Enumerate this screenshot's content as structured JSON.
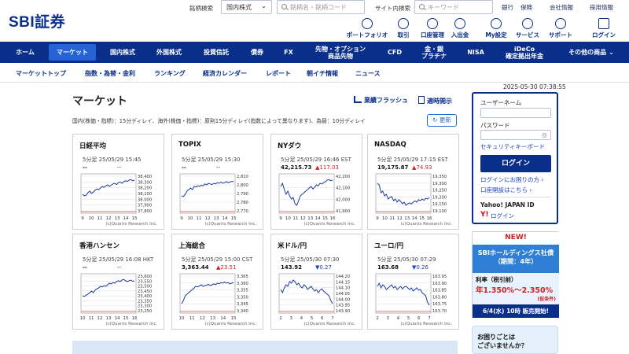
{
  "header": {
    "logo": "SBI証券",
    "search_label": "銘柄検索",
    "market_select": "国内株式",
    "stock_search_placeholder": "銘柄名・銘柄コード",
    "site_search_label": "サイト内検索",
    "keyword_placeholder": "キーワード",
    "links": [
      "銀行",
      "保険",
      "会社情報",
      "採用情報"
    ],
    "icons": [
      {
        "label": "ポートフォリオ",
        "icon": "portfolio-icon"
      },
      {
        "label": "取引",
        "icon": "trade-icon"
      },
      {
        "label": "口座管理",
        "icon": "account-icon"
      },
      {
        "label": "入出金",
        "icon": "yen-icon"
      },
      {
        "label": "My設定",
        "icon": "user-settings-icon"
      },
      {
        "label": "サービス",
        "icon": "services-icon"
      },
      {
        "label": "サポート",
        "icon": "support-icon"
      },
      {
        "label": "ログイン",
        "icon": "login-icon"
      }
    ]
  },
  "nav": [
    "ホーム",
    "マーケット",
    "国内株式",
    "外国株式",
    "投資信託",
    "債券",
    "FX",
    "先物・オプション\n商品先物",
    "CFD",
    "金・銀\nプラチナ",
    "NISA",
    "iDeCo\n確定拠出年金",
    "その他の商品"
  ],
  "subnav": [
    "マーケットトップ",
    "指数・為替・金利",
    "ランキング",
    "経済カレンダー",
    "レポート",
    "朝イチ情報",
    "ニュース"
  ],
  "timestamp": "2025-05-30 07:38:55",
  "page_title": "マーケット",
  "header_links": [
    "業績フラッシュ",
    "適時開示"
  ],
  "delay_note": "国内(株価・指標)：15分ディレイ、海外(株価・指標)：原則15分ディレイ(指数によって異なります)、為替：10分ディレイ",
  "refresh_label": "更新",
  "credit": "(c)Quants Research Inc.",
  "cards": [
    {
      "name": "日経平均",
      "time": "5分足 25/05/29 15:45",
      "price": "--",
      "change": "--",
      "dir": "none",
      "y_ticks": [
        "38,400",
        "38,300",
        "38,200",
        "38,100",
        "38,000",
        "37,900",
        "37,800"
      ],
      "x_ticks": [
        "9",
        "10",
        "11",
        "12",
        "13",
        "14",
        "15"
      ],
      "series": [
        0.55,
        0.6,
        0.58,
        0.5,
        0.45,
        0.52,
        0.48,
        0.42,
        0.38,
        0.4,
        0.35,
        0.3,
        0.33,
        0.28,
        0.25,
        0.3,
        0.26,
        0.22,
        0.2,
        0.24,
        0.18,
        0.16,
        0.2,
        0.15,
        0.12,
        0.14,
        0.1,
        0.08,
        0.12,
        0.1
      ]
    },
    {
      "name": "TOPIX",
      "time": "5分足 25/05/29 15:30",
      "price": "--",
      "change": "--",
      "dir": "none",
      "y_ticks": [
        "2,810",
        "2,800",
        "2,790",
        "2,780",
        "2,770"
      ],
      "x_ticks": [
        "9",
        "10",
        "11",
        "12",
        "13",
        "14",
        "15"
      ],
      "series": [
        0.6,
        0.62,
        0.55,
        0.45,
        0.4,
        0.35,
        0.4,
        0.3,
        0.32,
        0.28,
        0.3,
        0.26,
        0.28,
        0.22,
        0.25,
        0.2,
        0.22,
        0.24,
        0.2,
        0.22,
        0.18,
        0.2,
        0.16,
        0.2,
        0.18,
        0.15,
        0.18,
        0.16,
        0.14,
        0.15
      ]
    },
    {
      "name": "NYダウ",
      "time": "5分足 25/05/29 16:46 EST",
      "price": "42,215.73",
      "change": "▲117.03",
      "dir": "up",
      "y_ticks": [
        "42,200",
        "42,100",
        "42,000",
        "41,900"
      ],
      "x_ticks": [
        "9",
        "10",
        "11",
        "12",
        "13",
        "14",
        "15",
        "16"
      ],
      "series": [
        0.3,
        0.2,
        0.4,
        0.55,
        0.45,
        0.6,
        0.7,
        0.65,
        0.85,
        0.9,
        0.75,
        0.6,
        0.55,
        0.5,
        0.45,
        0.4,
        0.35,
        0.3,
        0.38,
        0.32,
        0.25,
        0.28,
        0.2,
        0.22,
        0.18,
        0.15,
        0.1,
        0.08,
        0.12,
        0.1
      ]
    },
    {
      "name": "NASDAQ",
      "time": "5分足 25/05/29 17:15 EST",
      "price": "19,175.87",
      "change": "▲74.93",
      "dir": "up",
      "y_ticks": [
        "19,350",
        "19,300",
        "19,250",
        "19,200",
        "19,150",
        "19,100"
      ],
      "x_ticks": [
        "9",
        "10",
        "11",
        "12",
        "13",
        "14",
        "15",
        "16"
      ],
      "series": [
        0.2,
        0.25,
        0.5,
        0.45,
        0.6,
        0.55,
        0.7,
        0.65,
        0.62,
        0.75,
        0.7,
        0.8,
        0.72,
        0.78,
        0.85,
        0.8,
        0.9,
        0.85,
        0.82,
        0.86,
        0.8,
        0.76,
        0.8,
        0.72,
        0.75,
        0.7,
        0.74,
        0.68,
        0.7,
        0.66
      ]
    },
    {
      "name": "香港ハンセン",
      "time": "5分足 25/05/29 16:08 HKT",
      "price": "--",
      "change": "--",
      "dir": "none",
      "y_ticks": [
        "23,600",
        "23,550",
        "23,500",
        "23,450",
        "23,400",
        "23,350",
        "23,300",
        "23,250"
      ],
      "x_ticks": [
        "10",
        "11",
        "12",
        "13",
        "14",
        "15",
        "16"
      ],
      "series": [
        0.6,
        0.62,
        0.58,
        0.55,
        0.5,
        0.45,
        0.5,
        0.42,
        0.38,
        0.35,
        0.3,
        0.32,
        0.28,
        0.3,
        0.25,
        0.2,
        0.22,
        0.18,
        0.2,
        0.15,
        0.12,
        0.15,
        0.1,
        0.08,
        0.12,
        0.15,
        0.12,
        0.1,
        0.14,
        0.12
      ]
    },
    {
      "name": "上海総合",
      "time": "5分足 25/05/29 15:00 CST",
      "price": "3,363.44",
      "change": "▲23.51",
      "dir": "up",
      "y_ticks": [
        "3,365",
        "3,360",
        "3,355",
        "3,350",
        "3,345",
        "3,340"
      ],
      "x_ticks": [
        "10",
        "11",
        "12",
        "13",
        "14",
        "15"
      ],
      "series": [
        0.85,
        0.75,
        0.6,
        0.55,
        0.5,
        0.45,
        0.4,
        0.35,
        0.3,
        0.32,
        0.28,
        0.25,
        0.3,
        0.28,
        0.26,
        0.24,
        0.28,
        0.25,
        0.22,
        0.25,
        0.2,
        0.22,
        0.18,
        0.2,
        0.16,
        0.2,
        0.18,
        0.22,
        0.2,
        0.18
      ]
    },
    {
      "name": "米ドル/円",
      "time": "5分足 25/05/30 07:30",
      "price": "143.92",
      "change": "▼0.27",
      "dir": "dn",
      "y_ticks": [
        "144.20",
        "144.15",
        "144.10",
        "144.05",
        "144.00",
        "143.95",
        "143.90"
      ],
      "x_ticks": [
        "2",
        "3",
        "4",
        "5",
        "6",
        "7"
      ],
      "series": [
        0.4,
        0.5,
        0.35,
        0.25,
        0.3,
        0.15,
        0.2,
        0.1,
        0.15,
        0.25,
        0.2,
        0.3,
        0.35,
        0.25,
        0.3,
        0.4,
        0.35,
        0.3,
        0.38,
        0.45,
        0.4,
        0.5,
        0.42,
        0.38,
        0.45,
        0.5,
        0.55,
        0.6,
        0.75,
        0.85
      ]
    },
    {
      "name": "ユーロ/円",
      "time": "5分足 25/05/30 07:29",
      "price": "163.68",
      "change": "▼0.26",
      "dir": "dn",
      "y_ticks": [
        "163.95",
        "163.90",
        "163.85",
        "163.80",
        "163.75",
        "163.70"
      ],
      "x_ticks": [
        "2",
        "3",
        "4",
        "5",
        "6",
        "7"
      ],
      "series": [
        0.3,
        0.2,
        0.35,
        0.25,
        0.3,
        0.4,
        0.35,
        0.3,
        0.25,
        0.35,
        0.3,
        0.4,
        0.35,
        0.3,
        0.38,
        0.32,
        0.3,
        0.35,
        0.4,
        0.35,
        0.45,
        0.4,
        0.35,
        0.42,
        0.4,
        0.5,
        0.55,
        0.6,
        0.8,
        0.9
      ]
    }
  ],
  "login": {
    "user_label": "ユーザーネーム",
    "password_label": "パスワード",
    "security_kb": "セキュリティキーボード",
    "button": "ログイン",
    "trouble_link": "ログインにお困りの方",
    "open_account": "口座開設はこちら",
    "yahoo_label": "Yahoo! JAPAN ID",
    "yahoo_login": "ログイン"
  },
  "banner": {
    "new": "NEW!",
    "line1": "SBIホールディングス社債",
    "line2": "（期間：4年）",
    "rate_label": "利率（税引前）",
    "rate": "年1.350%〜2.350%",
    "rate_note": "(仮条件)",
    "date": "6/4(水) 10時 販売開始!"
  },
  "help": "お困りごとは\nございませんか？"
}
